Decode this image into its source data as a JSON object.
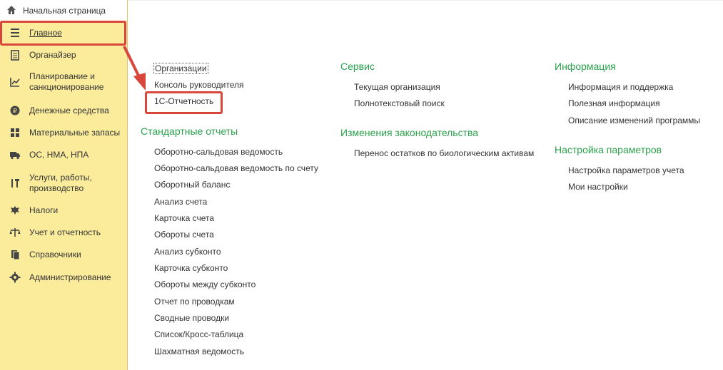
{
  "sidebar": {
    "home_label": "Начальная страница",
    "items": [
      {
        "label": "Главное",
        "icon": "menu-icon"
      },
      {
        "label": "Органайзер",
        "icon": "notepad-icon"
      },
      {
        "label": "Планирование и санкционирование",
        "icon": "planning-icon"
      },
      {
        "label": "Денежные средства",
        "icon": "money-icon"
      },
      {
        "label": "Материальные запасы",
        "icon": "grid-icon"
      },
      {
        "label": "ОС, НМА, НПА",
        "icon": "truck-icon"
      },
      {
        "label": "Услуги, работы, производство",
        "icon": "tools-icon"
      },
      {
        "label": "Налоги",
        "icon": "eagle-icon"
      },
      {
        "label": "Учет и отчетность",
        "icon": "scales-icon"
      },
      {
        "label": "Справочники",
        "icon": "books-icon"
      },
      {
        "label": "Администрирование",
        "icon": "gear-icon"
      }
    ]
  },
  "col1": {
    "links_top": [
      "Организации",
      "Консоль руководителя",
      "1С-Отчетность"
    ],
    "heading": "Стандартные отчеты",
    "links": [
      "Оборотно-сальдовая ведомость",
      "Оборотно-сальдовая ведомость по счету",
      "Оборотный баланс",
      "Анализ счета",
      "Карточка счета",
      "Обороты счета",
      "Анализ субконто",
      "Карточка субконто",
      "Обороты между субконто",
      "Отчет по проводкам",
      "Сводные проводки",
      "Список/Кросс-таблица",
      "Шахматная ведомость"
    ]
  },
  "col2": {
    "heading1": "Сервис",
    "links1": [
      "Текущая организация",
      "Полнотекстовый поиск"
    ],
    "heading2": "Изменения законодательства",
    "links2": [
      "Перенос остатков по биологическим активам"
    ]
  },
  "col3": {
    "heading1": "Информация",
    "links1": [
      "Информация и поддержка",
      "Полезная информация",
      "Описание изменений программы"
    ],
    "heading2": "Настройка параметров",
    "links2": [
      "Настройка параметров учета",
      "Мои настройки"
    ]
  },
  "colors": {
    "accent_green": "#2ba24c",
    "highlight_red": "#d9463b",
    "sidebar_bg": "#fbec9c"
  }
}
